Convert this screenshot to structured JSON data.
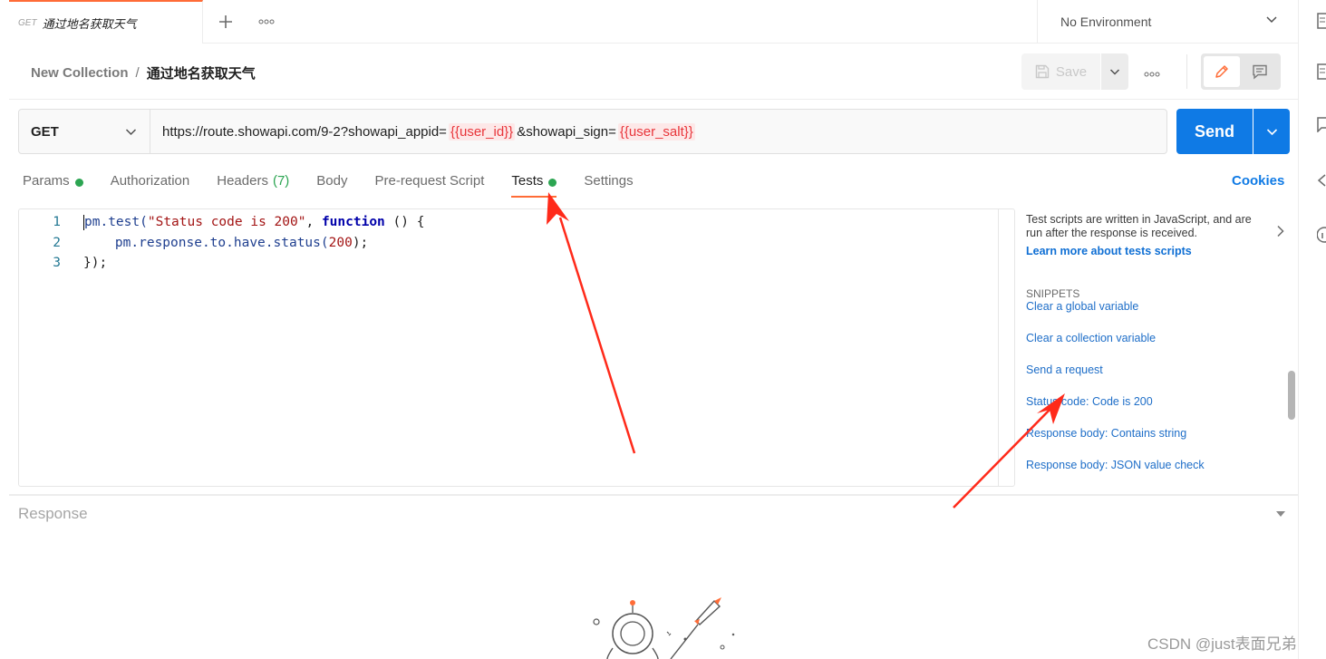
{
  "tab": {
    "method": "GET",
    "name": "通过地名获取天气"
  },
  "environment": {
    "label": "No Environment"
  },
  "breadcrumb": {
    "collection": "New Collection",
    "separator": "/",
    "request": "通过地名获取天气"
  },
  "toolbar": {
    "save_label": "Save"
  },
  "request": {
    "method": "GET",
    "url_parts": {
      "part1": "https://route.showapi.com/9-2?showapi_appid=",
      "var1": "{{user_id}}",
      "part2": "&showapi_sign=",
      "var2": "{{user_salt}}"
    },
    "send_label": "Send"
  },
  "request_tabs": {
    "params": "Params",
    "authorization": "Authorization",
    "headers": "Headers",
    "headers_count": "(7)",
    "body": "Body",
    "prerequest": "Pre-request Script",
    "tests": "Tests",
    "settings": "Settings",
    "cookies": "Cookies"
  },
  "editor": {
    "lines": [
      {
        "num": "1"
      },
      {
        "num": "2"
      },
      {
        "num": "3"
      }
    ],
    "code": {
      "l1_obj": "pm",
      "l1_rest": ".test(",
      "l1_str": "\"Status code is 200\"",
      "l1_comma": ", ",
      "l1_kw": "function",
      "l1_end": " () {",
      "l2_pre": "    pm.response.to.have.status(",
      "l2_num": "200",
      "l2_end": ");",
      "l3": "});"
    }
  },
  "side_panel": {
    "description": "Test scripts are written in JavaScript, and are run after the response is received.",
    "learn_more": "Learn more about tests scripts",
    "snippets_heading": "SNIPPETS",
    "snippets": [
      "Clear a global variable",
      "Clear a collection variable",
      "Send a request",
      "Status code: Code is 200",
      "Response body: Contains string",
      "Response body: JSON value check"
    ]
  },
  "response": {
    "label": "Response"
  },
  "watermark": "CSDN @just表面兄弟",
  "colors": {
    "accent": "#ff6c37",
    "send": "#0f7ae5",
    "variable": "#e8353a",
    "status_dot": "#2ca552",
    "annotation_arrow": "#ff2a1a"
  }
}
